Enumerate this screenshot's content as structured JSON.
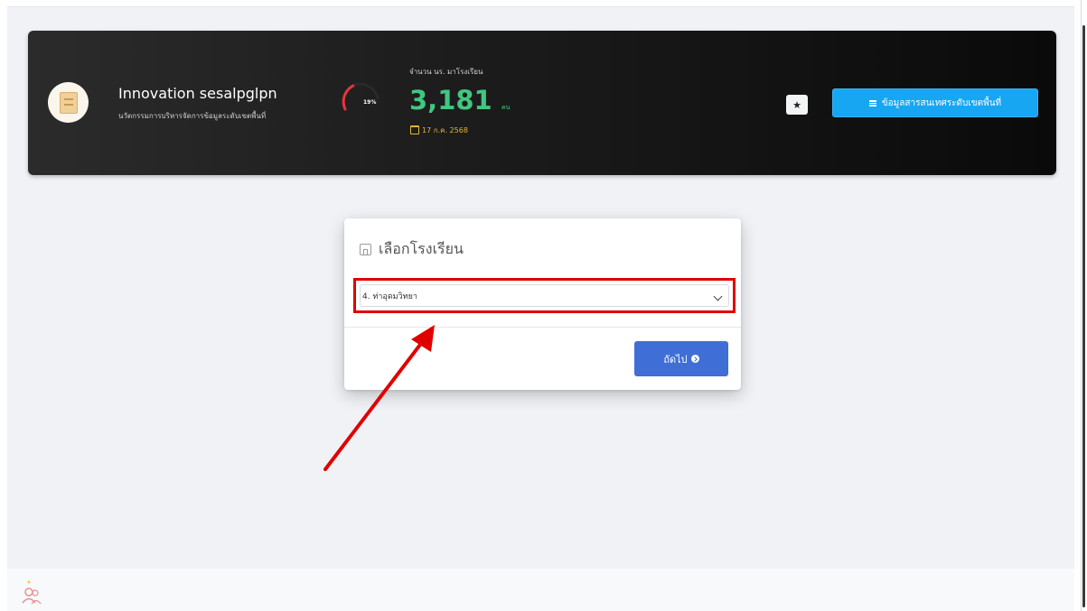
{
  "header": {
    "brand_title": "Innovation sesalpglpn",
    "brand_subtitle": "นวัตกรรมการบริหารจัดการข้อมูลระดับเขตพื้นที่",
    "gauge_text": "19%",
    "stat_label": "จำนวน นร. มาโรงเรียน",
    "stat_value": "3,181",
    "stat_unit": "คน",
    "stat_date": "17 ก.ค. 2568",
    "info_button_label": "ข้อมูลสารสนเทศระดับเขตพื้นที่",
    "colors": {
      "stat_green": "#41c77f",
      "date_yellow": "#e0b43a",
      "info_blue": "#16a6f2",
      "gauge_red": "#e8333c"
    }
  },
  "modal": {
    "title": "เลือกโรงเรียน",
    "selected_school": "4. ท่าอุดมวิทยา",
    "next_button_label": "ถัดไป",
    "colors": {
      "next_blue": "#3f6fd6",
      "highlight_red": "#e00000"
    }
  },
  "icons": {
    "logo": "book-icon",
    "star": "star-icon",
    "info": "list-icon",
    "school": "school-icon",
    "next": "arrow-circle-right-icon",
    "footer": "users-icon"
  }
}
